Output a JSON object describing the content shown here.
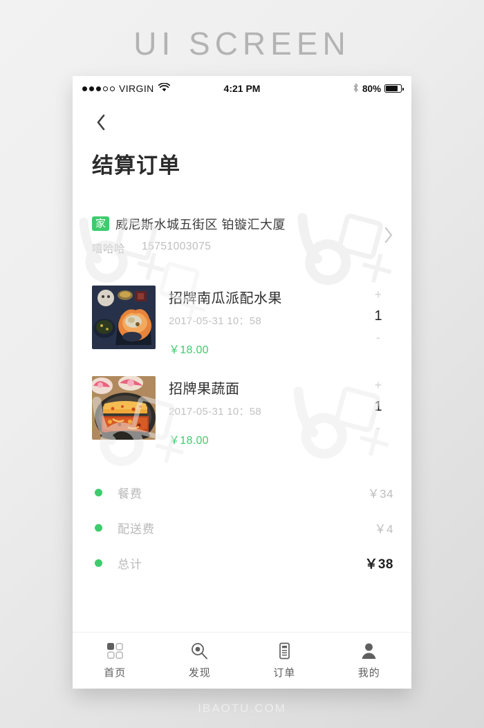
{
  "poster": {
    "title": "UI SCREEN",
    "footer": "IBAOTU.COM"
  },
  "statusbar": {
    "carrier": "VIRGIN",
    "time": "4:21 PM",
    "battery_percent": "80%",
    "signal_dots_filled": 3,
    "signal_dots_total": 5,
    "wifi_icon": "wifi-icon",
    "bluetooth_icon": "bluetooth-icon"
  },
  "nav": {
    "back_icon": "chevron-left-icon",
    "title": "结算订单"
  },
  "address": {
    "badge": "家",
    "badge_color": "#3ecb6d",
    "line": "威尼斯水城五街区  铂镟汇大厦",
    "contact_name": "嘻哈哈",
    "phone": "15751003075",
    "arrow_icon": "chevron-right-icon"
  },
  "items": [
    {
      "name": "招牌南瓜派配水果",
      "date": "2017-05-31  10：58",
      "price": "￥18.00",
      "quantity": "1",
      "plus_label": "+",
      "minus_label": "-",
      "image_name": "crab-dish-photo"
    },
    {
      "name": "招牌果蔬面",
      "date": "2017-05-31  10：58",
      "price": "￥18.00",
      "quantity": "1",
      "plus_label": "+",
      "minus_label": "-",
      "image_name": "hotpot-dish-photo"
    }
  ],
  "summary": [
    {
      "label": "餐费",
      "value": "￥34"
    },
    {
      "label": "配送费",
      "value": "￥4"
    },
    {
      "label": "总计",
      "value": "￥38"
    }
  ],
  "tabbar": [
    {
      "label": "首页",
      "icon": "grid-icon"
    },
    {
      "label": "发现",
      "icon": "search-icon"
    },
    {
      "label": "订单",
      "icon": "document-icon"
    },
    {
      "label": "我的",
      "icon": "person-icon"
    }
  ],
  "colors": {
    "accent_green": "#3ecb6d",
    "muted_text": "#bdbdbd",
    "dark_text": "#2b2b2b"
  }
}
